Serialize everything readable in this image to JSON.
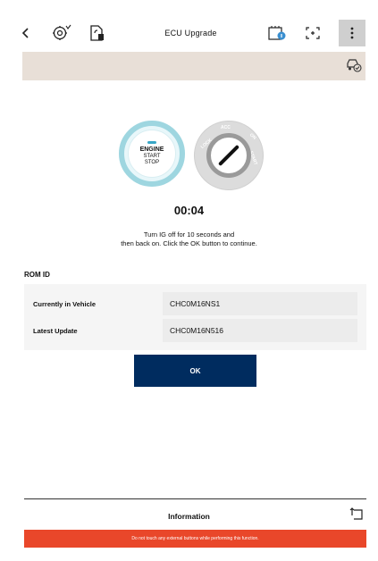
{
  "header": {
    "title": "ECU Upgrade",
    "icons": [
      "back-icon",
      "settings-badge-icon",
      "file-upload-icon",
      "ecu-info-icon",
      "fullscreen-icon",
      "more-vertical-icon"
    ]
  },
  "strip": {
    "icon": "car-check-icon"
  },
  "illustration": {
    "engine_line1": "ENGINE",
    "engine_line2": "START",
    "engine_line3": "STOP",
    "dial_lock": "LOCK",
    "dial_acc": "ACC",
    "dial_on": "ON",
    "dial_start": "START"
  },
  "timer": "00:04",
  "instruction": {
    "line1": "Turn IG off for 10 seconds and",
    "line2": "then back on. Click the OK button to continue."
  },
  "rom": {
    "title": "ROM ID",
    "rows": [
      {
        "label": "Currently in Vehicle",
        "value": "CHC0M16NS1"
      },
      {
        "label": "Latest Update",
        "value": "CHC0M16N516"
      }
    ]
  },
  "ok_label": "OK",
  "info": {
    "title": "Information",
    "icon": "collapse-icon"
  },
  "warning": "Do not touch any external buttons while performing this function.",
  "colors": {
    "primary": "#002c5f",
    "warning": "#e9472a",
    "strip": "#e8dfd7",
    "engine_accent": "#9ed6e0"
  }
}
